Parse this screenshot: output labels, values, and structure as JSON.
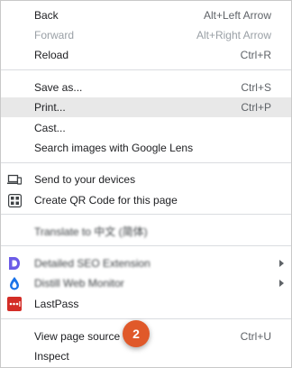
{
  "menu": {
    "back": {
      "label": "Back",
      "shortcut": "Alt+Left Arrow"
    },
    "forward": {
      "label": "Forward",
      "shortcut": "Alt+Right Arrow"
    },
    "reload": {
      "label": "Reload",
      "shortcut": "Ctrl+R"
    },
    "save_as": {
      "label": "Save as...",
      "shortcut": "Ctrl+S"
    },
    "print": {
      "label": "Print...",
      "shortcut": "Ctrl+P"
    },
    "cast": {
      "label": "Cast..."
    },
    "search_lens": {
      "label": "Search images with Google Lens"
    },
    "send_devices": {
      "label": "Send to your devices",
      "icon": "laptop-phone-icon"
    },
    "qr_code": {
      "label": "Create QR Code for this page",
      "icon": "qr-code-icon"
    },
    "translate": {
      "label": "Translate to 中文 (简体)"
    },
    "ext1": {
      "label": "Detailed SEO Extension",
      "icon": "d-logo-icon",
      "color": "#6c5ce7"
    },
    "ext2": {
      "label": "Distill Web Monitor",
      "icon": "drop-icon",
      "color": "#1a73e8"
    },
    "lastpass": {
      "label": "LastPass",
      "icon": "lastpass-icon",
      "color": "#d32d27"
    },
    "view_source": {
      "label": "View page source",
      "shortcut": "Ctrl+U"
    },
    "inspect": {
      "label": "Inspect"
    }
  },
  "badge": {
    "number": "2",
    "color": "#e0592a"
  }
}
